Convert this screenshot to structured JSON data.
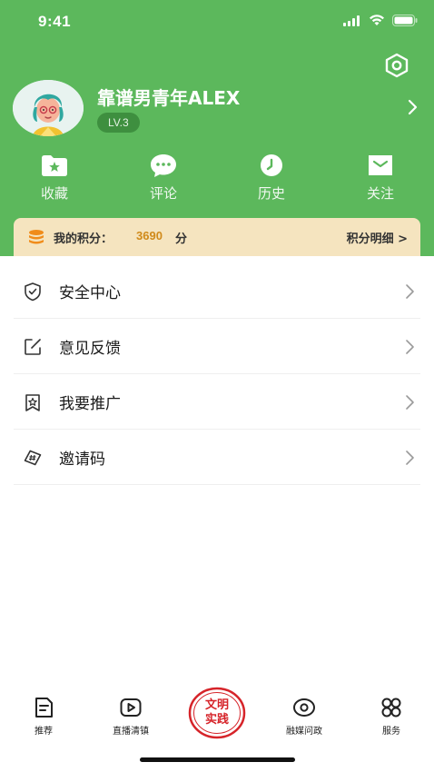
{
  "status_bar": {
    "time": "9:41"
  },
  "profile": {
    "username": "靠谱男青年ALEX",
    "level": "LV.3"
  },
  "shortcuts": [
    {
      "label": "收藏",
      "icon": "favorites-folder-icon"
    },
    {
      "label": "评论",
      "icon": "comment-bubble-icon"
    },
    {
      "label": "历史",
      "icon": "history-clock-icon"
    },
    {
      "label": "关注",
      "icon": "follow-envelope-icon"
    }
  ],
  "points": {
    "label": "我的积分：",
    "value": "3690",
    "unit": "分",
    "detail": "积分明细 >"
  },
  "menu": [
    {
      "label": "安全中心",
      "icon": "shield-check-icon"
    },
    {
      "label": "意见反馈",
      "icon": "feedback-edit-icon"
    },
    {
      "label": "我要推广",
      "icon": "promote-star-icon"
    },
    {
      "label": "邀请码",
      "icon": "invite-code-icon"
    }
  ],
  "bottom_nav": [
    {
      "label": "推荐",
      "icon": "recommend-doc-icon"
    },
    {
      "label": "直播清镇",
      "icon": "live-play-icon"
    },
    {
      "label": "文明实践",
      "icon": "civilization-practice-stamp-icon"
    },
    {
      "label": "融媒问政",
      "icon": "eye-icon"
    },
    {
      "label": "服务",
      "icon": "services-grid-icon"
    }
  ],
  "colors": {
    "header_green": "#5cb85c",
    "points_bg": "#f5e4bf",
    "points_value": "#d08a1a",
    "stamp_red": "#d6242a"
  }
}
